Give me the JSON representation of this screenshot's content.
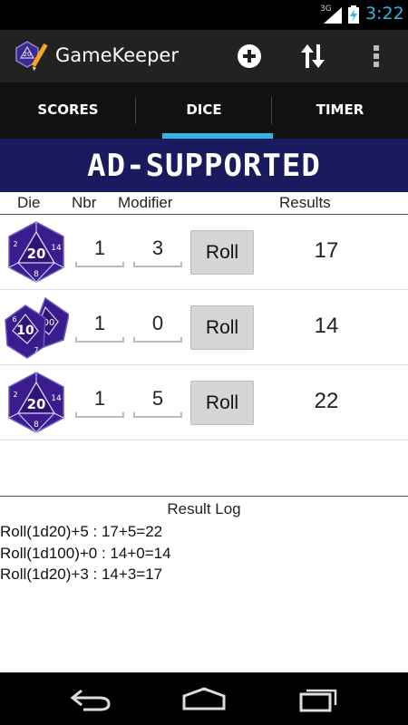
{
  "status": {
    "network": "3G",
    "time": "3:22"
  },
  "app": {
    "title": "GameKeeper"
  },
  "actions": [
    {
      "name": "add-icon"
    },
    {
      "name": "sort-icon"
    },
    {
      "name": "overflow-menu-icon"
    }
  ],
  "tabs": [
    {
      "label": "SCORES",
      "selected": false
    },
    {
      "label": "DICE",
      "selected": true
    },
    {
      "label": "TIMER",
      "selected": false
    }
  ],
  "ad": {
    "text": "AD-SUPPORTED"
  },
  "columns": {
    "die": "Die",
    "nbr": "Nbr",
    "modifier": "Modifier",
    "results": "Results"
  },
  "rows": [
    {
      "die": "d20-icon",
      "nbr": "1",
      "modifier": "3",
      "roll_label": "Roll",
      "result": "17"
    },
    {
      "die": "d100-icon",
      "nbr": "1",
      "modifier": "0",
      "roll_label": "Roll",
      "result": "14"
    },
    {
      "die": "d20-icon",
      "nbr": "1",
      "modifier": "5",
      "roll_label": "Roll",
      "result": "22"
    }
  ],
  "log": {
    "title": "Result Log",
    "entries": [
      "Roll(1d20)+5 : 17+5=22",
      "Roll(1d100)+0 : 14+0=14",
      "Roll(1d20)+3 : 14+3=17"
    ]
  },
  "colors": {
    "accent": "#33b5e5",
    "ad_background": "#1a1b5e",
    "die_purple": "#3a1c8c"
  }
}
